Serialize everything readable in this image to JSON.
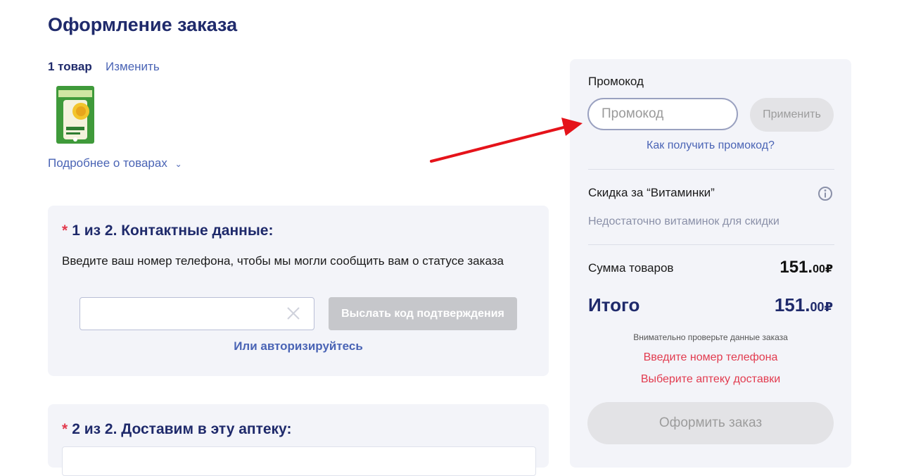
{
  "page": {
    "title": "Оформление заказа"
  },
  "cart": {
    "items_count": "1 товар",
    "change_label": "Изменить",
    "details_label": "Подробнее о товарах"
  },
  "step1": {
    "star": "*",
    "title": "1 из 2. Контактные данные:",
    "description": "Введите ваш номер телефона, чтобы мы могли сообщить вам о статусе заказа",
    "phone_value": "",
    "send_code_label": "Выслать код подтверждения",
    "auth_link": "Или авторизируйтесь"
  },
  "step2": {
    "star": "*",
    "title": "2 из 2. Доставим в эту аптеку:"
  },
  "sidebar": {
    "promo_label": "Промокод",
    "promo_placeholder": "Промокод",
    "apply_label": "Применить",
    "promo_how": "Как получить промокод?",
    "vitamins_title": "Скидка за “Витаминки”",
    "vitamins_note": "Недостаточно витаминок для скидки",
    "sum_label": "Сумма товаров",
    "sum_int": "151.",
    "sum_cents": "00",
    "currency": "₽",
    "total_label": "Итого",
    "total_int": "151.",
    "total_cents": "00",
    "check_note": "Внимательно проверьте данные заказа",
    "error_phone": "Введите номер телефона",
    "error_pharmacy": "Выберите аптеку доставки",
    "checkout_label": "Оформить заказ"
  },
  "colors": {
    "accent": "#1f2a6b",
    "link": "#4a64b5",
    "error": "#e23b4f",
    "card_bg": "#f3f4f9",
    "annotation_arrow": "#e5131a"
  },
  "icons": {
    "clear": "close-icon",
    "info": "info-icon",
    "chevron": "chevron-down-icon"
  }
}
